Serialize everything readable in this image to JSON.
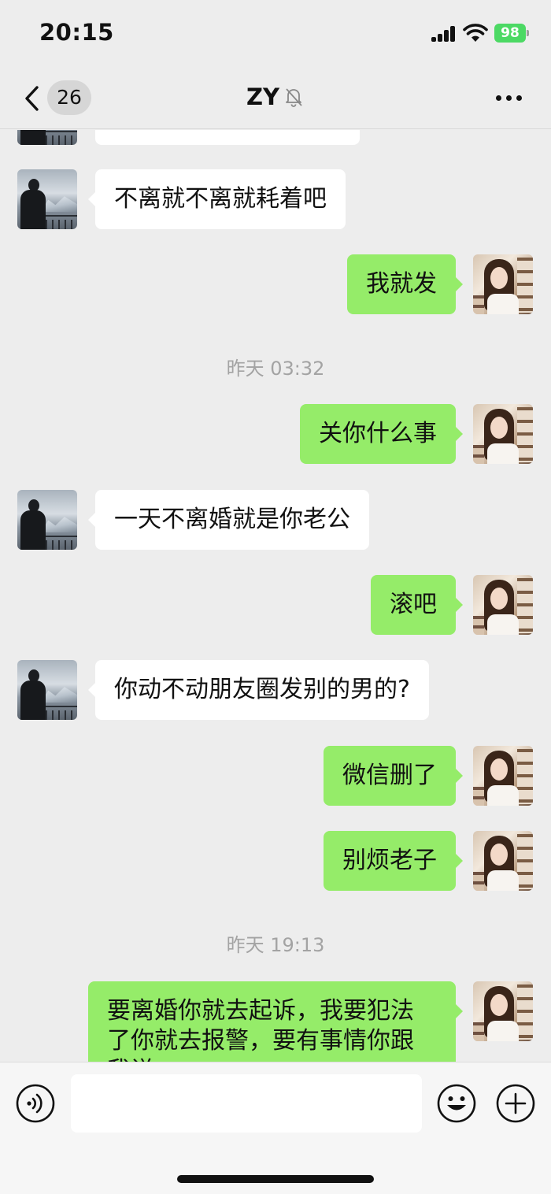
{
  "status_bar": {
    "time": "20:15",
    "battery": "98"
  },
  "nav": {
    "unread_count": "26",
    "title": "ZY"
  },
  "messages": [
    {
      "id": 0,
      "side": "in",
      "text": ""
    },
    {
      "id": 1,
      "side": "in",
      "text": "不离就不离就耗着吧"
    },
    {
      "id": 2,
      "side": "out",
      "text": "我就发"
    },
    {
      "id": 3,
      "type": "timestamp",
      "text": "昨天 03:32"
    },
    {
      "id": 4,
      "side": "out",
      "text": "关你什么事"
    },
    {
      "id": 5,
      "side": "in",
      "text": "一天不离婚就是你老公"
    },
    {
      "id": 6,
      "side": "out",
      "text": "滚吧"
    },
    {
      "id": 7,
      "side": "in",
      "text": "你动不动朋友圈发别的男的?"
    },
    {
      "id": 8,
      "side": "out",
      "text": "微信删了"
    },
    {
      "id": 9,
      "side": "out",
      "text": "别烦老子"
    },
    {
      "id": 10,
      "type": "timestamp",
      "text": "昨天 19:13"
    },
    {
      "id": 11,
      "side": "out",
      "text": "要离婚你就去起诉，我要犯法了你就去报警，要有事情你跟我说"
    }
  ],
  "input": {
    "placeholder": "",
    "value": ""
  },
  "icons": {
    "back": "chevron-left-icon",
    "mute": "bell-off-icon",
    "more": "more-icon",
    "voice": "voice-icon",
    "emoji": "emoji-icon",
    "plus": "plus-icon"
  },
  "colors": {
    "bubble_out": "#95ec69",
    "bubble_in": "#ffffff",
    "background": "#ededed",
    "battery": "#4cd964"
  }
}
